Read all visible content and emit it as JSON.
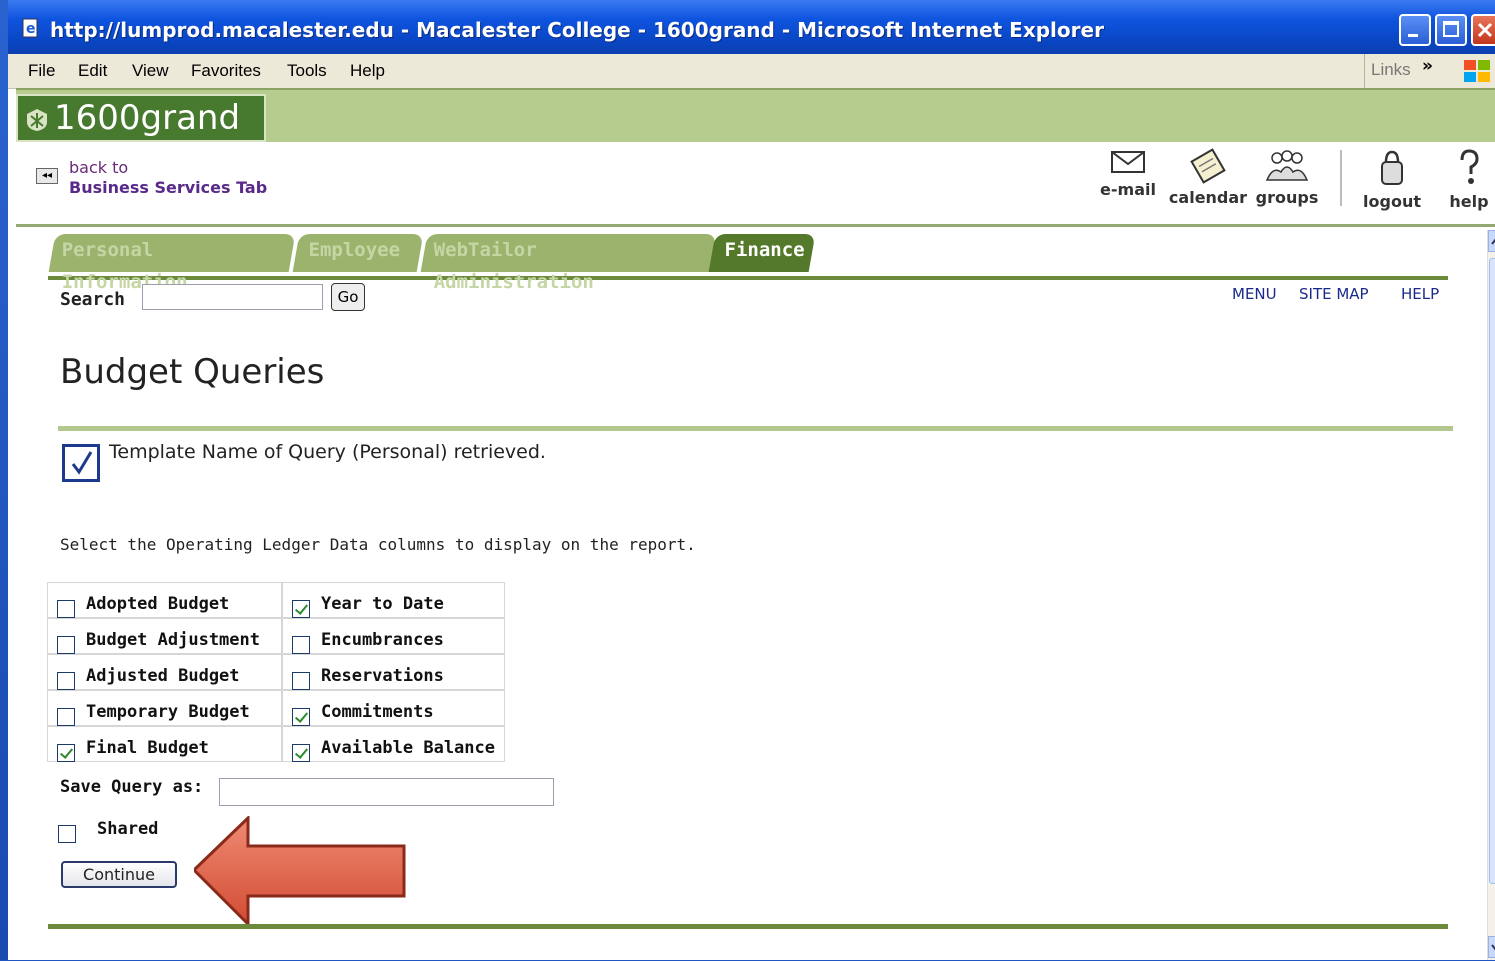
{
  "window": {
    "title": "http://lumprod.macalester.edu - Macalester College - 1600grand - Microsoft Internet Explorer"
  },
  "menu": {
    "items": [
      "File",
      "Edit",
      "View",
      "Favorites",
      "Tools",
      "Help"
    ],
    "links_label": "Links"
  },
  "banner": {
    "logo_text": "1600grand"
  },
  "header": {
    "back_to": "back to",
    "back_link": "Business Services Tab",
    "icons": [
      {
        "label": "e-mail",
        "icon": "envelope-icon"
      },
      {
        "label": "calendar",
        "icon": "calendar-icon"
      },
      {
        "label": "groups",
        "icon": "groups-icon"
      },
      {
        "label": "logout",
        "icon": "lock-icon"
      },
      {
        "label": "help",
        "icon": "question-icon"
      }
    ]
  },
  "tabs": [
    {
      "label": "Personal Information",
      "active": false
    },
    {
      "label": "Employee",
      "active": false
    },
    {
      "label": "WebTailor Administration",
      "active": false
    },
    {
      "label": "Finance",
      "active": true
    }
  ],
  "search": {
    "label": "Search",
    "value": "",
    "go_label": "Go"
  },
  "top_links": [
    "MENU",
    "SITE MAP",
    "HELP"
  ],
  "page": {
    "title": "Budget Queries",
    "info_message": "Template Name of Query (Personal) retrieved.",
    "instruction": "Select the Operating Ledger Data columns to display on the report."
  },
  "columns": {
    "left": [
      {
        "label": "Adopted Budget",
        "checked": false
      },
      {
        "label": "Budget Adjustment",
        "checked": false
      },
      {
        "label": "Adjusted Budget",
        "checked": false
      },
      {
        "label": "Temporary Budget",
        "checked": false
      },
      {
        "label": "Final Budget",
        "checked": true
      }
    ],
    "right": [
      {
        "label": "Year to Date",
        "checked": true
      },
      {
        "label": "Encumbrances",
        "checked": false
      },
      {
        "label": "Reservations",
        "checked": false
      },
      {
        "label": "Commitments",
        "checked": true
      },
      {
        "label": "Available Balance",
        "checked": true
      }
    ]
  },
  "save_query": {
    "label": "Save Query as:",
    "value": ""
  },
  "shared": {
    "label": "Shared",
    "checked": false
  },
  "continue_label": "Continue",
  "colors": {
    "accent_green": "#55792a",
    "banner_green": "#b5cc8e",
    "link_blue": "#1a2a8a",
    "arrow_red": "#e0604a"
  }
}
